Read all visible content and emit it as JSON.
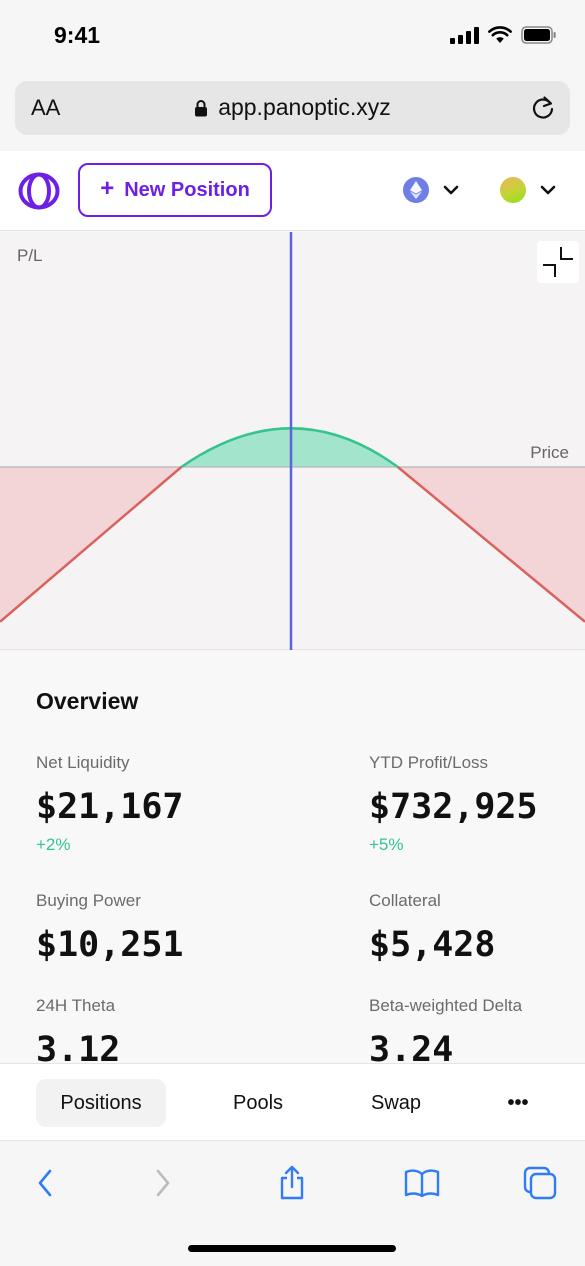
{
  "status": {
    "time": "9:41"
  },
  "browser": {
    "text_size_label": "AA",
    "url": "app.panoptic.xyz"
  },
  "header": {
    "new_position_label": "New Position",
    "chain_icon": "ethereum-icon",
    "brand_color": "#6d1fe6"
  },
  "chart": {
    "y_label": "P/L",
    "x_label": "Price"
  },
  "chart_data": {
    "type": "line",
    "xlabel": "Price",
    "ylabel": "P/L",
    "series": [
      {
        "x": [
          0,
          0.31,
          0.5,
          0.68,
          1
        ],
        "y": [
          -0.36,
          0,
          0.09,
          0,
          -0.36
        ]
      }
    ],
    "profit_color": "#35c38e",
    "loss_color": "#d9625e",
    "current_price_line_color": "#5b63e0",
    "grid": false
  },
  "overview": {
    "title": "Overview",
    "metrics": [
      {
        "label": "Net Liquidity",
        "value": "$21,167",
        "change": "+2%"
      },
      {
        "label": "YTD Profit/Loss",
        "value": "$732,925",
        "change": "+5%"
      },
      {
        "label": "Buying Power",
        "value": "$10,251"
      },
      {
        "label": "Collateral",
        "value": "$5,428"
      },
      {
        "label": "24H Theta",
        "value": "3.12"
      },
      {
        "label": "Beta-weighted Delta",
        "value": "3.24"
      }
    ]
  },
  "tabs": [
    {
      "label": "Positions",
      "active": true
    },
    {
      "label": "Pools"
    },
    {
      "label": "Swap"
    },
    {
      "label": "•••"
    }
  ]
}
